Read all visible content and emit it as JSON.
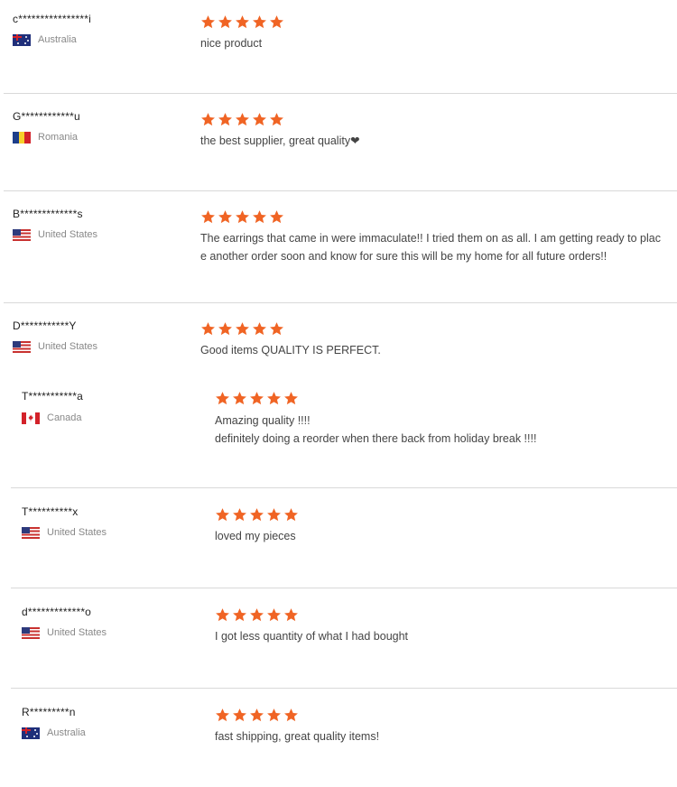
{
  "colors": {
    "star": "#f06424",
    "divider": "#d9d9d9"
  },
  "reviews": [
    {
      "user": "c****************i",
      "country": "Australia",
      "flag": "australia-flag-icon",
      "rating": 5,
      "text": "nice product"
    },
    {
      "user": "G************u",
      "country": "Romania",
      "flag": "romania-flag-icon",
      "rating": 5,
      "text": "the best supplier, great quality❤"
    },
    {
      "user": "B*************s",
      "country": "United States",
      "flag": "us-flag-icon",
      "rating": 5,
      "text": "The earrings that came in were immaculate!! I tried them on as all. I am getting ready to plac\ne another order soon and know for sure this will be my home for all future orders!!"
    },
    {
      "user": "D***********Y",
      "country": "United States",
      "flag": "us-flag-icon",
      "rating": 5,
      "text": "Good items QUALITY IS PERFECT."
    },
    {
      "user": "T***********a",
      "country": "Canada",
      "flag": "canada-flag-icon",
      "rating": 5,
      "text": "Amazing quality !!!!\ndefinitely doing a reorder when there back from holiday break !!!!"
    },
    {
      "user": "T**********x",
      "country": "United States",
      "flag": "us-flag-icon",
      "rating": 5,
      "text": "loved my pieces"
    },
    {
      "user": "d*************o",
      "country": "United States",
      "flag": "us-flag-icon",
      "rating": 5,
      "text": "I got less quantity of what I had bought"
    },
    {
      "user": "R*********n",
      "country": "Australia",
      "flag": "australia-flag-icon",
      "rating": 5,
      "text": "fast shipping, great quality items!"
    }
  ]
}
